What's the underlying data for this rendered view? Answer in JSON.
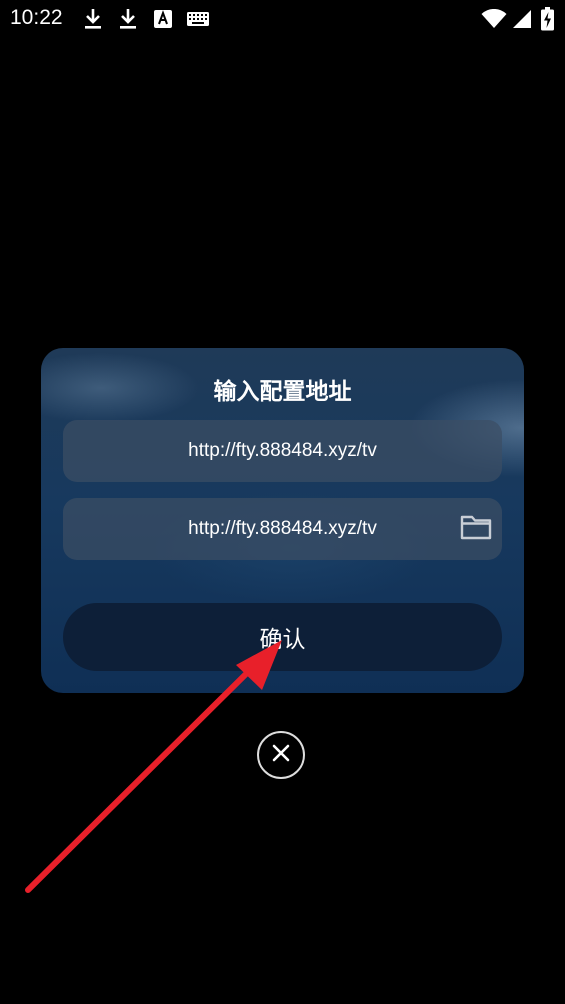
{
  "status_bar": {
    "time": "10:22",
    "left_icons": [
      "download-icon",
      "download-icon",
      "text-a-icon",
      "keyboard-icon"
    ],
    "right_icons": [
      "wifi-icon",
      "signal-icon",
      "battery-icon"
    ]
  },
  "dialog": {
    "title": "输入配置地址",
    "url_field_1": {
      "value": "http://fty.888484.xyz/tv"
    },
    "url_field_2": {
      "value": "http://fty.888484.xyz/tv",
      "icon": "folder-icon"
    },
    "confirm_label": "确认"
  },
  "close_button": {
    "icon": "close-icon"
  },
  "annotation": {
    "type": "arrow",
    "color": "#e8202a"
  }
}
